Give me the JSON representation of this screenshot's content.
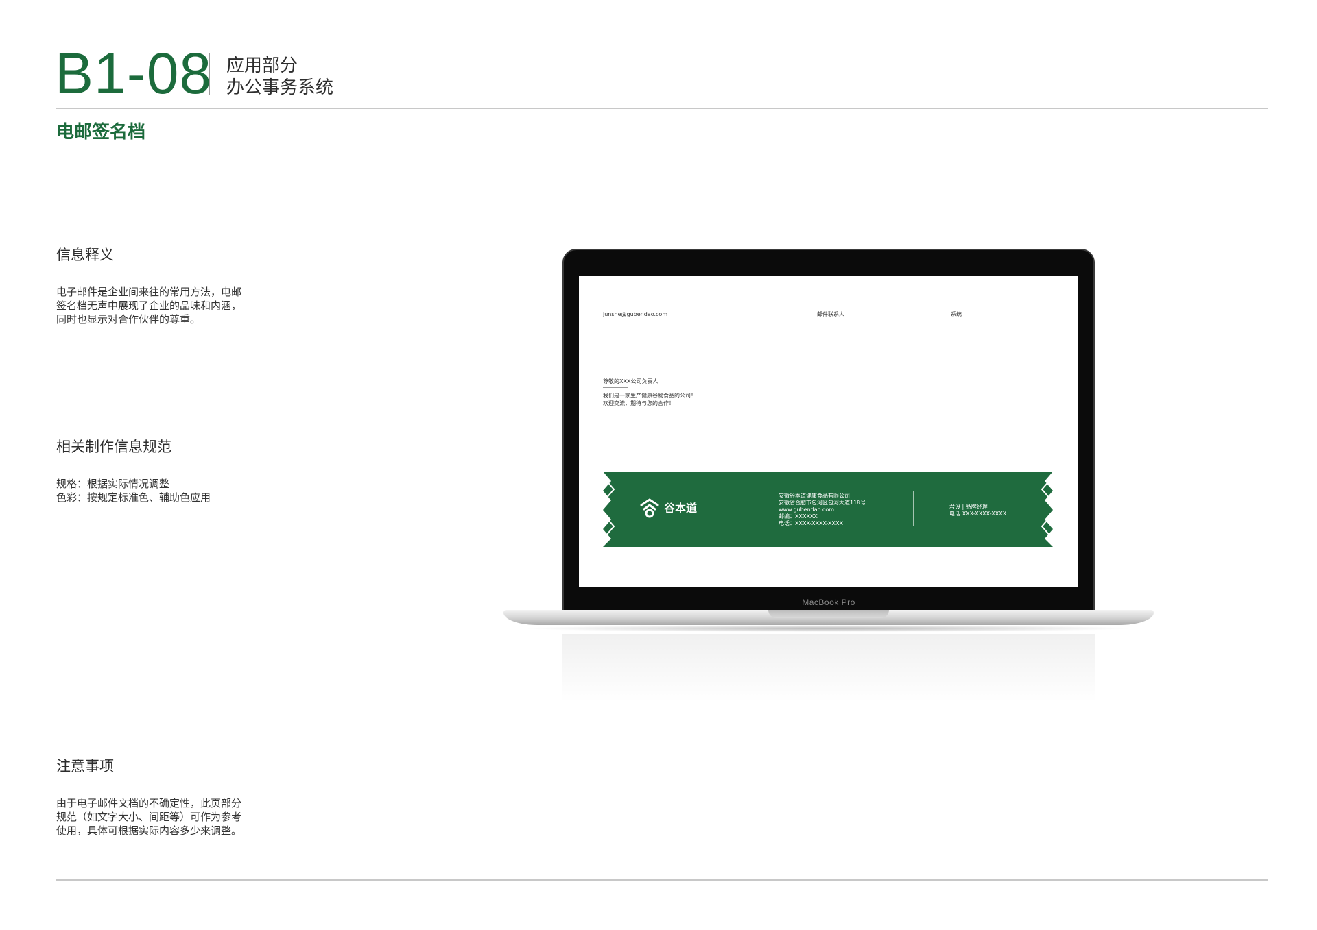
{
  "header": {
    "code": "B1-08",
    "subtitle_line1": "应用部分",
    "subtitle_line2": "办公事务系统",
    "section_title": "电邮签名档"
  },
  "info": {
    "title": "信息释义",
    "text": "电子邮件是企业间来往的常用方法，电邮\n签名档无声中展现了企业的品味和内涵，\n同时也显示对合作伙伴的尊重。"
  },
  "spec": {
    "title": "相关制作信息规范",
    "text": "规格：根据实际情况调整\n色彩：按规定标准色、辅助色应用"
  },
  "notes": {
    "title": "注意事项",
    "text": "由于电子邮件文档的不确定性，此页部分\n规范（如文字大小、间距等）可作为参考\n使用，具体可根据实际内容多少来调整。"
  },
  "laptop": {
    "model_label": "MacBook Pro"
  },
  "email": {
    "from": "junshe@gubendao.com",
    "to": "邮件联系人",
    "subject": "系统",
    "greeting": "尊敬的XXX公司负责人",
    "body": "我们是一家生产健康谷物食品的公司！\n欢迎交流，期待与您的合作！",
    "signature": {
      "brand": "谷本道",
      "company_info": "安徽谷本道健康食品有限公司\n安徽省合肥市包河区包河大道118号\nwww.gubendao.com\n邮编：XXXXXX\n电话：XXXX-XXXX-XXXX",
      "person_info": "君设 | 品牌经理\n电话:XXX-XXXX-XXXX"
    }
  },
  "colors": {
    "brand_green": "#1f6b3e",
    "title_green": "#1c6b3c"
  },
  "icons": [
    "brand-logo-icon"
  ]
}
